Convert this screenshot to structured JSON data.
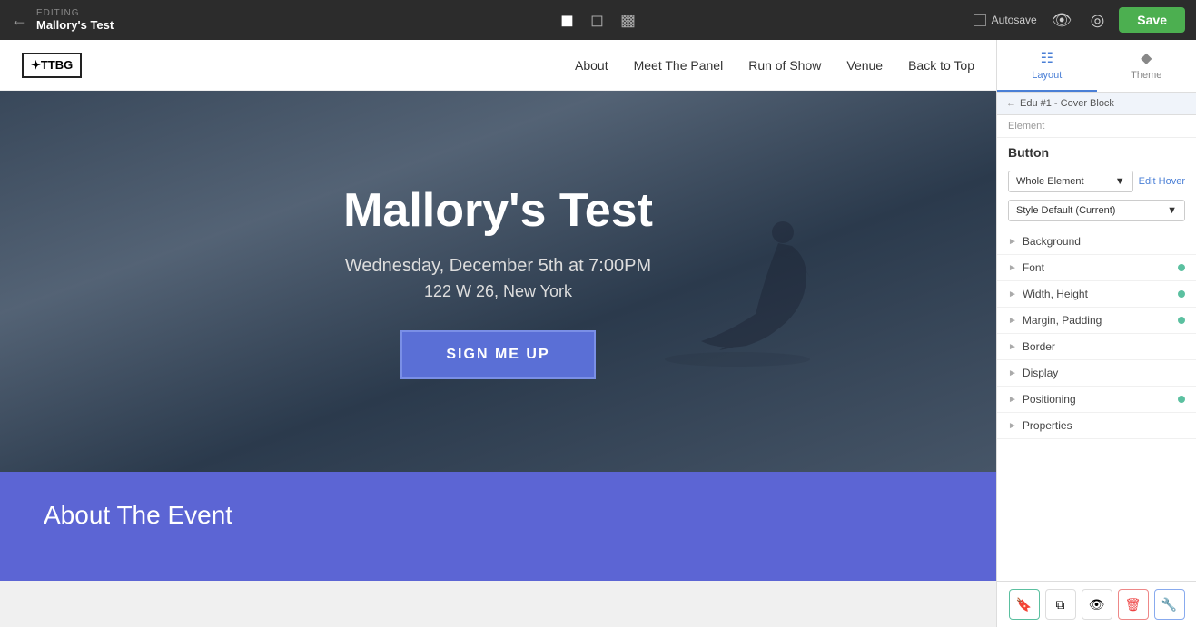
{
  "editor": {
    "editing_label": "EDITING",
    "page_name": "Mallory's Test",
    "save_button_label": "Save",
    "autosave_label": "Autosave"
  },
  "devices": [
    {
      "id": "desktop",
      "icon": "🖥",
      "active": true
    },
    {
      "id": "tablet",
      "icon": "▭",
      "active": false
    },
    {
      "id": "mobile",
      "icon": "📱",
      "active": false
    }
  ],
  "site_nav": {
    "logo_text": "✦TTBG",
    "links": [
      {
        "label": "About"
      },
      {
        "label": "Meet The Panel"
      },
      {
        "label": "Run of Show"
      },
      {
        "label": "Venue"
      },
      {
        "label": "Back to Top"
      }
    ]
  },
  "hero": {
    "title": "Mallory's Test",
    "date": "Wednesday, December 5th at 7:00PM",
    "address": "122 W 26, New York",
    "cta_button": "SIGN ME UP"
  },
  "about_section": {
    "title": "About The Event"
  },
  "right_panel": {
    "tabs": [
      {
        "id": "layout",
        "label": "Layout",
        "active": true
      },
      {
        "id": "theme",
        "label": "Theme",
        "active": false
      }
    ],
    "breadcrumb": {
      "arrow": "←",
      "text": "Edu #1 - Cover Block"
    },
    "element_label": "Element",
    "section_title": "Button",
    "whole_element_dropdown": "Whole Element",
    "edit_hover_label": "Edit Hover",
    "style_select": "Style Default (Current)",
    "properties": [
      {
        "label": "Background",
        "has_dot": false
      },
      {
        "label": "Font",
        "has_dot": true
      },
      {
        "label": "Width, Height",
        "has_dot": true
      },
      {
        "label": "Margin, Padding",
        "has_dot": true
      },
      {
        "label": "Border",
        "has_dot": false
      },
      {
        "label": "Display",
        "has_dot": false
      },
      {
        "label": "Positioning",
        "has_dot": true
      },
      {
        "label": "Properties",
        "has_dot": false
      }
    ],
    "action_buttons": [
      {
        "id": "bookmark",
        "icon": "🔖",
        "color": "green"
      },
      {
        "id": "copy",
        "icon": "⧉",
        "color": "normal"
      },
      {
        "id": "hide",
        "icon": "👁",
        "color": "normal"
      },
      {
        "id": "delete",
        "icon": "🗑",
        "color": "red"
      },
      {
        "id": "settings",
        "icon": "🔧",
        "color": "blue"
      }
    ]
  }
}
